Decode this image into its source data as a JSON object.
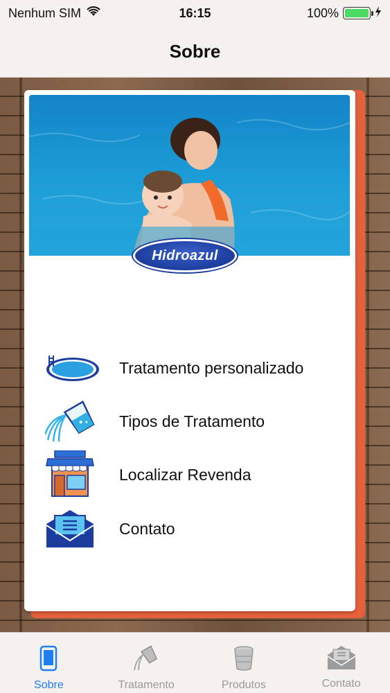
{
  "status_bar": {
    "carrier": "Nenhum SIM",
    "time": "16:15",
    "battery": "100%"
  },
  "nav": {
    "title": "Sobre"
  },
  "brand": {
    "logo": "Hidroazul"
  },
  "menu": [
    {
      "label": "Tratamento personalizado",
      "icon": "pool-icon"
    },
    {
      "label": "Tipos de Tratamento",
      "icon": "chemical-pour-icon"
    },
    {
      "label": "Localizar Revenda",
      "icon": "store-icon"
    },
    {
      "label": "Contato",
      "icon": "envelope-icon"
    }
  ],
  "tabs": [
    {
      "label": "Sobre",
      "icon": "phone-icon",
      "active": true
    },
    {
      "label": "Tratamento",
      "icon": "tratamento-icon",
      "active": false
    },
    {
      "label": "Produtos",
      "icon": "bucket-icon",
      "active": false
    },
    {
      "label": "Contato",
      "icon": "envelope-icon",
      "active": false
    }
  ],
  "colors": {
    "accent": "#1e7ff0",
    "card_border": "#e5603b",
    "water": "#1a9ad6",
    "logo_blue": "#1d3d9e"
  }
}
